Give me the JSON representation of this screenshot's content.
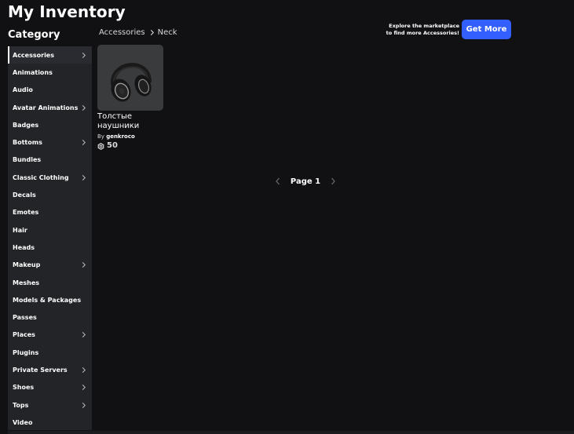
{
  "page": {
    "title": "My Inventory"
  },
  "sidebar": {
    "heading": "Category",
    "items": [
      {
        "label": "Accessories",
        "has_submenu": true,
        "active": true
      },
      {
        "label": "Animations",
        "has_submenu": false
      },
      {
        "label": "Audio",
        "has_submenu": false
      },
      {
        "label": "Avatar Animations",
        "has_submenu": true
      },
      {
        "label": "Badges",
        "has_submenu": false
      },
      {
        "label": "Bottoms",
        "has_submenu": true
      },
      {
        "label": "Bundles",
        "has_submenu": false
      },
      {
        "label": "Classic Clothing",
        "has_submenu": true
      },
      {
        "label": "Decals",
        "has_submenu": false
      },
      {
        "label": "Emotes",
        "has_submenu": false
      },
      {
        "label": "Hair",
        "has_submenu": false
      },
      {
        "label": "Heads",
        "has_submenu": false
      },
      {
        "label": "Makeup",
        "has_submenu": true
      },
      {
        "label": "Meshes",
        "has_submenu": false
      },
      {
        "label": "Models & Packages",
        "has_submenu": false
      },
      {
        "label": "Passes",
        "has_submenu": false
      },
      {
        "label": "Places",
        "has_submenu": true
      },
      {
        "label": "Plugins",
        "has_submenu": false
      },
      {
        "label": "Private Servers",
        "has_submenu": true
      },
      {
        "label": "Shoes",
        "has_submenu": true
      },
      {
        "label": "Tops",
        "has_submenu": true
      },
      {
        "label": "Video",
        "has_submenu": false
      }
    ]
  },
  "breadcrumb": {
    "parent": "Accessories",
    "current": "Neck"
  },
  "promo": {
    "line1": "Explore the marketplace",
    "line2": "to find more Accessories!",
    "button_label": "Get More"
  },
  "items": [
    {
      "name": "Толстые наушники",
      "by_label": "By",
      "creator": "genkroco",
      "price": "50",
      "icon": "headphones-icon"
    }
  ],
  "pagination": {
    "label": "Page 1"
  },
  "colors": {
    "background": "#111114",
    "sidebar": "#232428",
    "accent": "#335fff",
    "thumb": "#393b3d"
  }
}
